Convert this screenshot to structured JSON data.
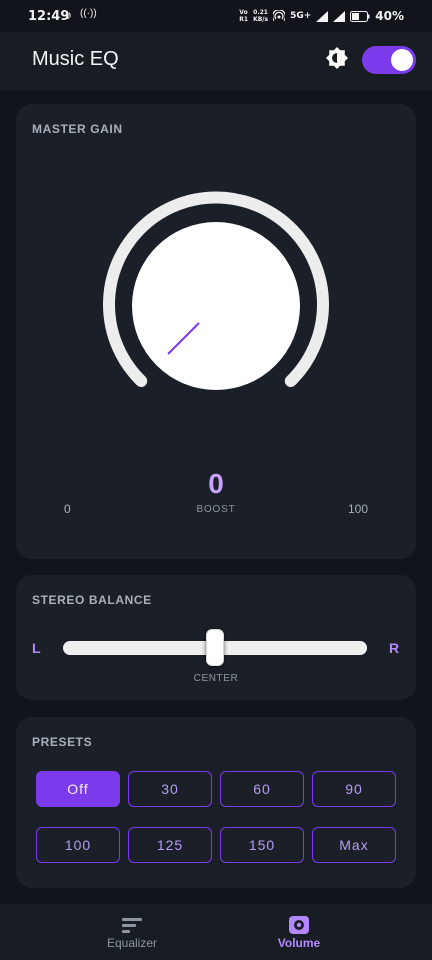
{
  "status_bar": {
    "time": "12:49",
    "volte": "Vo\nR1",
    "speed": "0.21\nKB/s",
    "network": "5G+",
    "battery_percent": "40%",
    "icons": [
      "music-note-icon",
      "radio-icon",
      "hotspot-icon",
      "signal-icon",
      "battery-icon"
    ]
  },
  "app_bar": {
    "title": "Music EQ",
    "theme_icon": "brightness-icon",
    "power_toggle_on": true
  },
  "master_gain": {
    "title": "MASTER GAIN",
    "value": "0",
    "value_label": "BOOST",
    "min_label": "0",
    "max_label": "100",
    "level_fraction": 0
  },
  "stereo_balance": {
    "title": "STEREO BALANCE",
    "left_label": "L",
    "right_label": "R",
    "center_label": "CENTER",
    "position_fraction": 0.5
  },
  "presets": {
    "title": "PRESETS",
    "items": [
      "Off",
      "30",
      "60",
      "90",
      "100",
      "125",
      "150",
      "Max"
    ],
    "selected": "Off"
  },
  "bottom_nav": {
    "items": [
      {
        "label": "Equalizer",
        "icon": "equalizer-icon",
        "active": false
      },
      {
        "label": "Volume",
        "icon": "speaker-icon",
        "active": true
      }
    ]
  },
  "colors": {
    "accent": "#7c3aed",
    "accent_light": "#b388ff",
    "background": "#11151b",
    "card": "#1b2028"
  }
}
